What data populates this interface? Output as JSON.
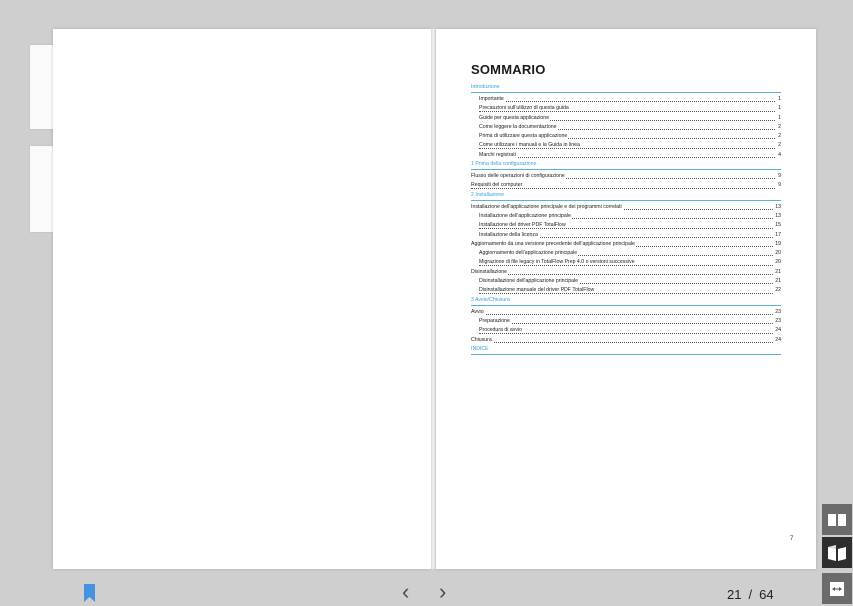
{
  "toc": {
    "title": "SOMMARIO",
    "sections": [
      {
        "heading": "Introduzione",
        "entries": [
          {
            "label": "Importante",
            "page": "1",
            "level": 2
          },
          {
            "label": "Precauzioni sull'utilizzo di questa guida",
            "page": "1",
            "level": 2
          },
          {
            "label": "Guide per questa applicazione",
            "page": "1",
            "level": 2
          },
          {
            "label": "Come leggere la documentazione",
            "page": "2",
            "level": 2
          },
          {
            "label": "Prima di utilizzare questa applicazione",
            "page": "2",
            "level": 2
          },
          {
            "label": "Come utilizzare i manuali e la Guida in linea",
            "page": "2",
            "level": 2
          },
          {
            "label": "Marchi registrati",
            "page": "4",
            "level": 2
          }
        ]
      },
      {
        "heading": "1 Prima della configurazione",
        "entries": [
          {
            "label": "Flusso delle operazioni di configurazione",
            "page": "9",
            "level": 1
          },
          {
            "label": "Requisiti del computer",
            "page": "9",
            "level": 1
          }
        ]
      },
      {
        "heading": "2 Installazione",
        "entries": [
          {
            "label": "Installazione dell'applicazione principale e dei programmi correlati",
            "page": "13",
            "level": 1
          },
          {
            "label": "Installazione dell'applicazione principale",
            "page": "13",
            "level": 2
          },
          {
            "label": "Installazione del driver PDF TotalFlow",
            "page": "15",
            "level": 2
          },
          {
            "label": "Installazione della licenza",
            "page": "17",
            "level": 2
          },
          {
            "label": "Aggiornamento da una versione precedente dell'applicazione principale",
            "page": "19",
            "level": 1
          },
          {
            "label": "Aggiornamento dell'applicazione principale",
            "page": "20",
            "level": 2
          },
          {
            "label": "Migrazione di file legacy in TotalFlow Prep 4.0 o versioni successive",
            "page": "20",
            "level": 2
          },
          {
            "label": "Disinstallazione",
            "page": "21",
            "level": 1
          },
          {
            "label": "Disinstallazione dell'applicazione principale",
            "page": "21",
            "level": 2
          },
          {
            "label": "Disinstallazione manuale del driver PDF TotalFlow",
            "page": "22",
            "level": 2
          }
        ]
      },
      {
        "heading": "3 Avvio/Chiusura",
        "entries": [
          {
            "label": "Avvio",
            "page": "23",
            "level": 1
          },
          {
            "label": "Preparazione",
            "page": "23",
            "level": 2
          },
          {
            "label": "Procedura di avvio",
            "page": "24",
            "level": 2
          },
          {
            "label": "Chiusura",
            "page": "24",
            "level": 1
          }
        ]
      },
      {
        "heading": "INDICE",
        "entries": []
      }
    ]
  },
  "page_number": "7",
  "toolbar": {
    "prev_glyph": "‹",
    "next_glyph": "›",
    "current_page": "21",
    "separator": "/",
    "total_pages": "64"
  },
  "view_buttons": [
    {
      "icon": "two-page-view-icon"
    },
    {
      "icon": "book-view-icon"
    },
    {
      "icon": "fit-width-icon"
    }
  ],
  "colors": {
    "accent": "#3aa0d8",
    "bookmark": "#4a90e2",
    "background": "#cfcfcf"
  }
}
